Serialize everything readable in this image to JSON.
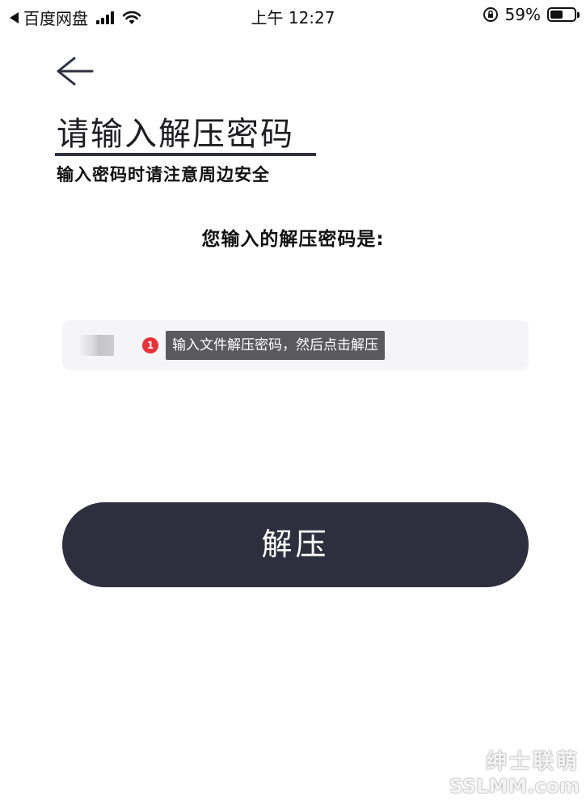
{
  "status_bar": {
    "back_app": "百度网盘",
    "time": "上午 12:27",
    "battery": "59%",
    "battery_level": 0.59,
    "icons": [
      "back-triangle-icon",
      "signal-icon",
      "wifi-icon",
      "rotation-lock-icon",
      "battery-icon"
    ]
  },
  "header": {
    "back_icon": "arrow-left-icon",
    "title": "请输入解压密码",
    "subtitle": "输入密码时请注意周边安全"
  },
  "main": {
    "prompt_label": "您输入的解压密码是:",
    "password_input": {
      "value_blurred": true
    },
    "annotation": {
      "badge_number": "1",
      "tooltip_text": "输入文件解压密码，然后点击解压",
      "badge_color": "#e8323a"
    },
    "unzip_button": "解压"
  },
  "watermark": {
    "line1": "绅士联萌",
    "line2": "SSLMM.com"
  },
  "colors": {
    "button_bg": "#2e2f3e",
    "input_bg": "#f5f5f7",
    "tooltip_bg": "#5a5a5e"
  }
}
